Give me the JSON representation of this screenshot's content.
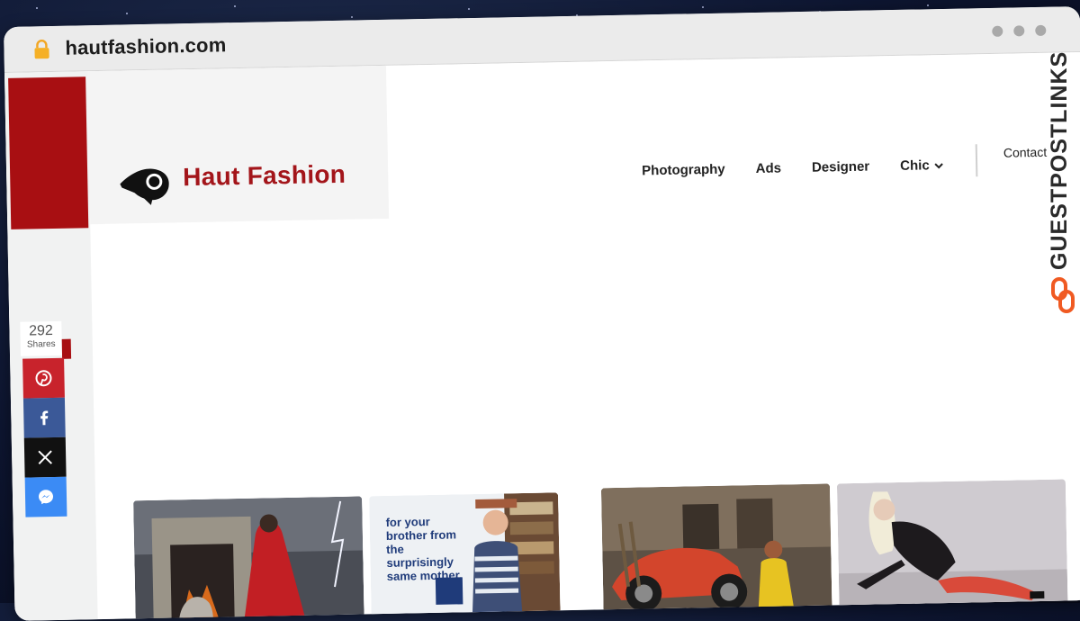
{
  "browser": {
    "url": "hautfashion.com"
  },
  "site": {
    "brand_name": "Haut Fashion",
    "brand_color": "#a3151a"
  },
  "nav": {
    "items": [
      {
        "label": "Photography"
      },
      {
        "label": "Ads"
      },
      {
        "label": "Designer"
      },
      {
        "label": "Chic"
      }
    ],
    "contact_label": "Contact"
  },
  "share": {
    "count": "292",
    "count_label": "Shares",
    "buttons": [
      {
        "icon": "pinterest-icon",
        "color": "#c8232c"
      },
      {
        "icon": "facebook-icon",
        "color": "#3b5998"
      },
      {
        "icon": "x-icon",
        "color": "#111111"
      },
      {
        "icon": "messenger-icon",
        "color": "#3b8bf5"
      }
    ]
  },
  "gallery": {
    "ad_text": "for your brother from the surprisingly same mother."
  },
  "watermark": {
    "text": "GUESTPOSTLINKS"
  }
}
